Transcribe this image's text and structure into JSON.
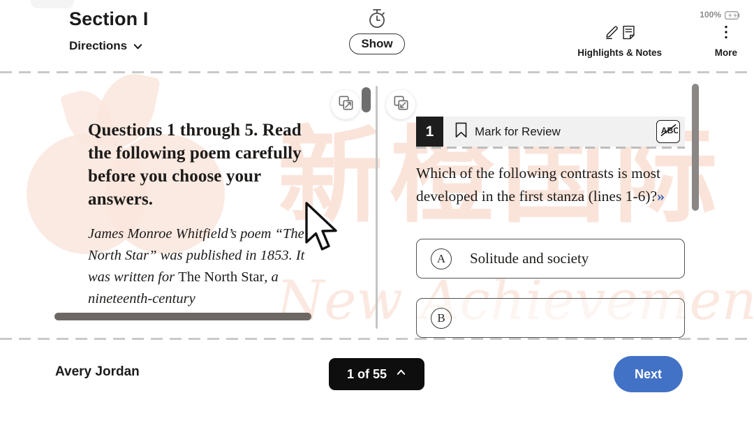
{
  "toolbar": {
    "section_title": "Section I",
    "directions_label": "Directions",
    "directions_icon": "chevron-down-icon",
    "timer_icon": "stopwatch-icon",
    "show_label": "Show",
    "battery_percent": "100%",
    "battery_icon": "battery-charging-icon",
    "highlights_label": "Highlights & Notes",
    "highlights_icon": "highlighter-pen-icon",
    "notes_icon": "note-page-icon",
    "more_label": "More",
    "more_icon": "vertical-dots-icon"
  },
  "passage": {
    "expand_icon_left": "expand-panel-icon",
    "expand_icon_right": "collapse-panel-icon",
    "heading": "Questions 1 through 5. Read the following poem carefully before you choose your answers.",
    "intro_italic_1": "James Monroe Whitfield’s poem “The North Star” was published in 1853. It was written for ",
    "intro_roman": "The North Star",
    "intro_italic_2": ", a nineteenth-century"
  },
  "question": {
    "number": "1",
    "mark_for_review_label": "Mark for Review",
    "mark_icon": "bookmark-icon",
    "cross_out_icon": "abc-strikethrough-icon",
    "stem": "Which of the following contrasts is most developed in the first stanza (lines 1-6)?",
    "stem_expand_icon": "double-chevron-right-icon",
    "choices": [
      {
        "letter": "A",
        "text": "Solitude and society"
      },
      {
        "letter": "B",
        "text": ""
      }
    ]
  },
  "bottom": {
    "student_name": "Avery Jordan",
    "page_indicator": "1 of 55",
    "page_indicator_icon": "chevron-up-icon",
    "next_label": "Next"
  },
  "watermark": {
    "cjk_text": "新橙国际",
    "script_text": "New Achievements",
    "logo": "peach-logo-watermark"
  },
  "colors": {
    "next_button": "#4272c6",
    "stem_chevron": "#3764b4",
    "page_pill": "#0e0e0e",
    "question_badge": "#1d1d1d",
    "watermark": "#fae4da"
  },
  "cursor": {
    "icon": "mouse-arrow-cursor"
  }
}
